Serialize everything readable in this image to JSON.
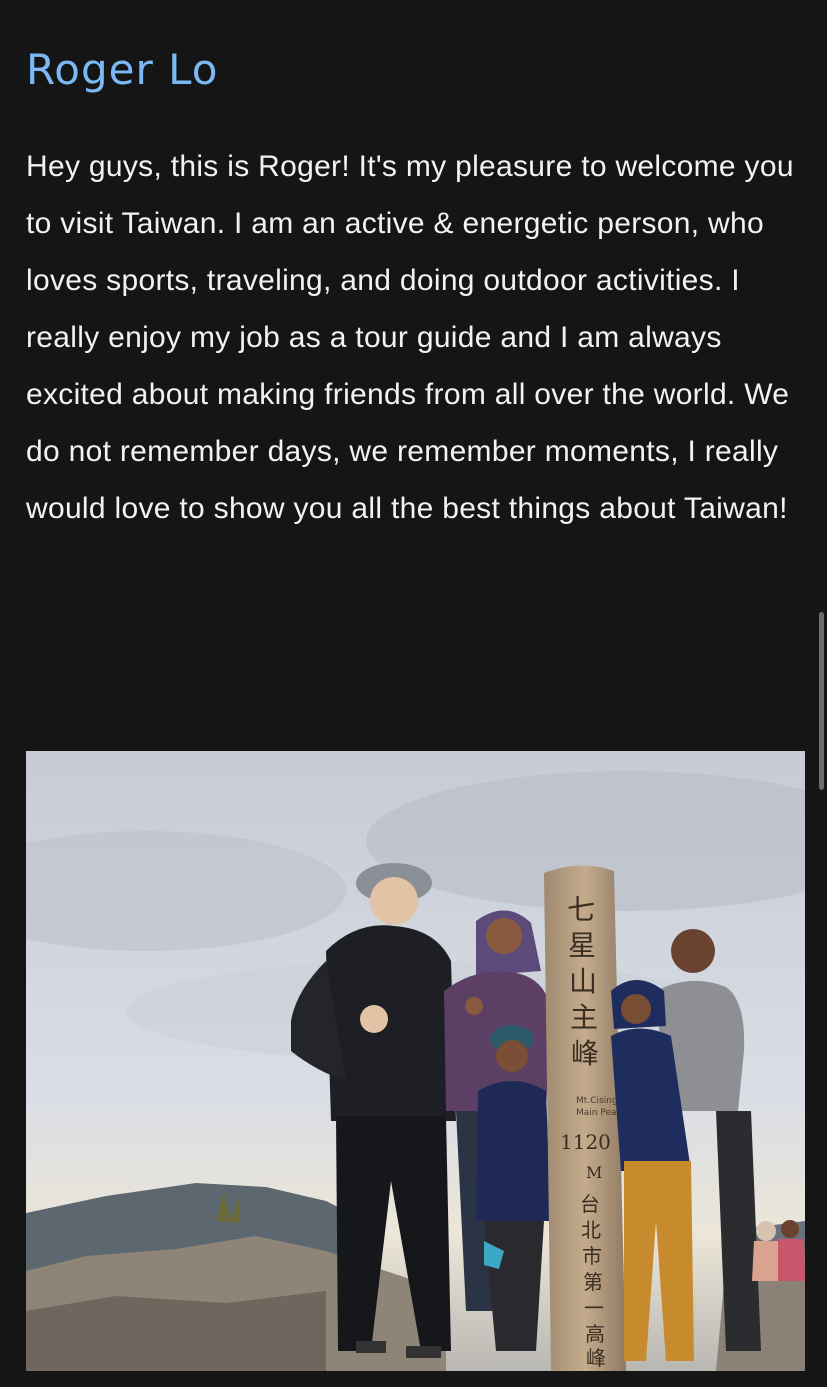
{
  "guide": {
    "name": "Roger Lo",
    "bio": "Hey guys, this is Roger! It's my pleasure to welcome you to visit Taiwan. I am an active & energetic person, who loves sports, traveling, and doing outdoor activities. I really enjoy my job as a tour guide and I am always excited about making friends from all over the world. We do not remember days, we remember moments, I really would love to show you all the best things about Taiwan!"
  },
  "photo": {
    "post_text_chinese": "七星山主峰",
    "post_text_english_1": "Mt.Cising",
    "post_text_english_2": "Main Peak",
    "post_elevation": "1120",
    "post_unit": "M",
    "post_text_chinese_2": "台北市第一高峰"
  },
  "colors": {
    "background": "#151515",
    "name": "#7bb8f5",
    "bio_text": "#f2f2f2"
  }
}
